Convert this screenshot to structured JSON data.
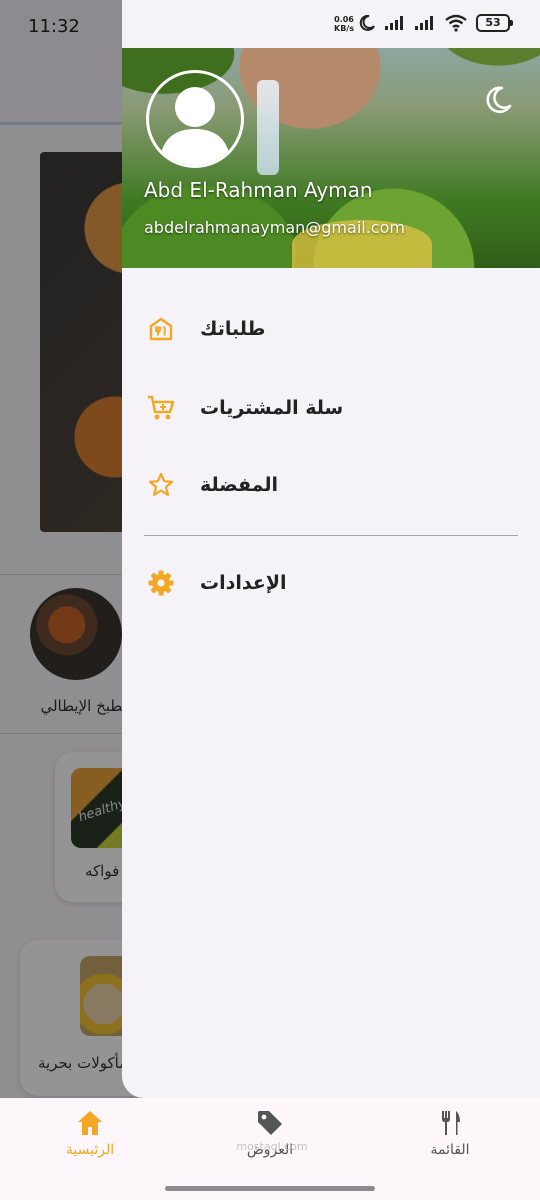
{
  "status_bar": {
    "time": "11:32",
    "net_speed_value": "0.06",
    "net_speed_unit": "KB/s",
    "battery": "53"
  },
  "background": {
    "category_label": "المطبخ الإيطالي",
    "card1_label": "فواكه",
    "card1_image_text": "healthy food",
    "card2_label": "مأكولات بحرية"
  },
  "drawer": {
    "user_name": "Abd El-Rahman Ayman",
    "user_email": "abdelrahmanayman@gmail.com",
    "items": [
      {
        "label": "طلباتك",
        "icon": "orders-icon"
      },
      {
        "label": "سلة المشتريات",
        "icon": "cart-icon"
      },
      {
        "label": "المفضلة",
        "icon": "star-icon"
      },
      {
        "label": "الإعدادات",
        "icon": "gear-icon"
      }
    ]
  },
  "bottom_nav": {
    "items": [
      {
        "label": "الرئيسية",
        "icon": "home-icon",
        "active": true
      },
      {
        "label": "العروض",
        "icon": "tag-icon",
        "active": false
      },
      {
        "label": "القائمة",
        "icon": "menu-utensils-icon",
        "active": false
      }
    ]
  },
  "watermark": "mostaql.com",
  "colors": {
    "accent": "#f5a623",
    "inactive": "#555555",
    "drawer_bg": "#f6f3f8"
  }
}
